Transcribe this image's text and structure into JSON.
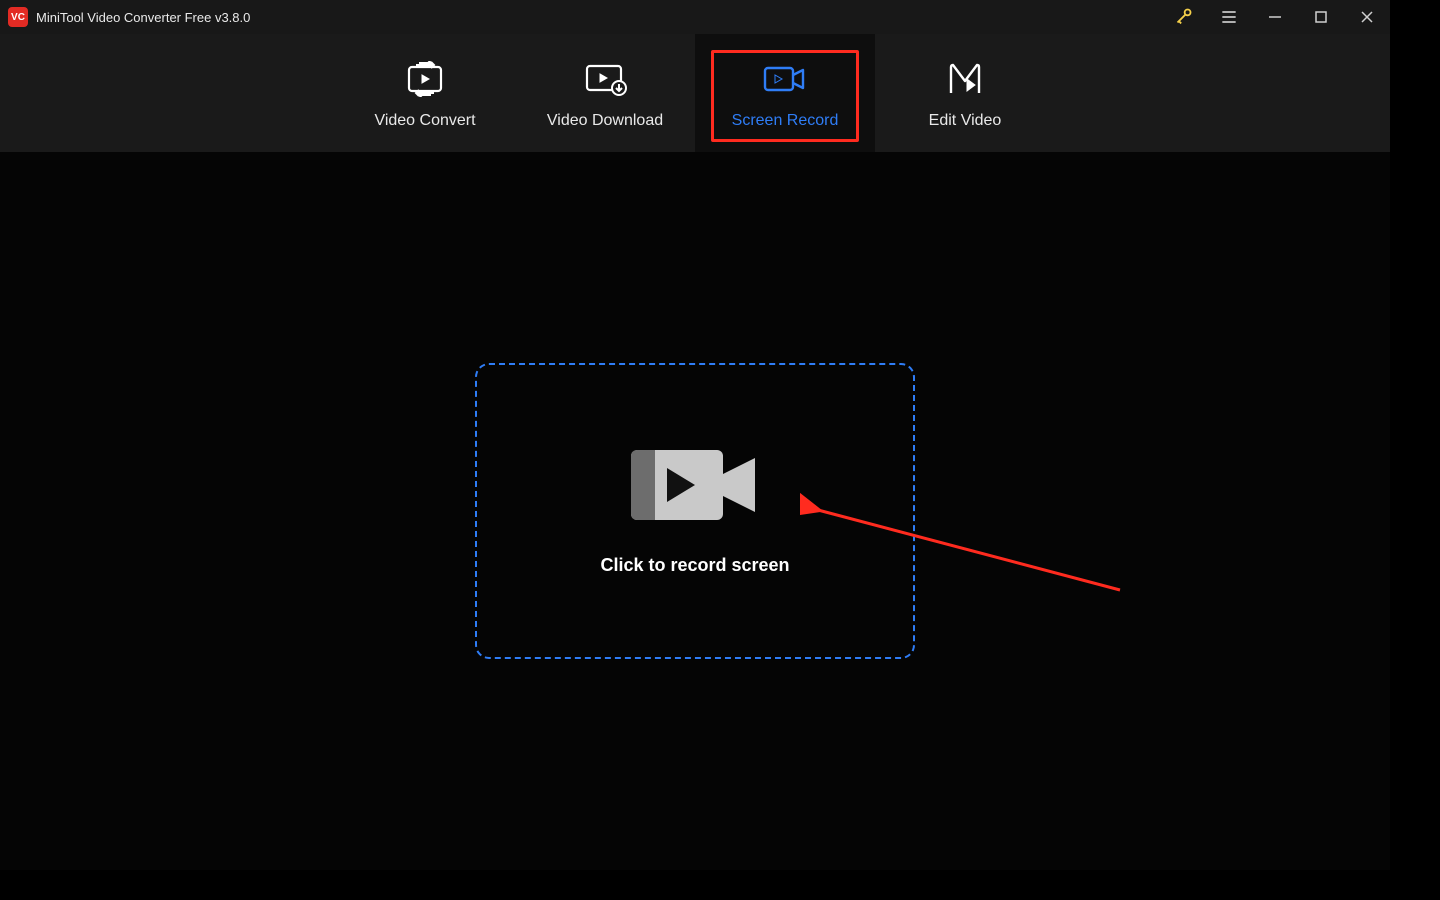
{
  "titlebar": {
    "app_abbrev": "VC",
    "title": "MiniTool Video Converter Free v3.8.0"
  },
  "tabs": {
    "convert": {
      "label": "Video Convert"
    },
    "download": {
      "label": "Video Download"
    },
    "record": {
      "label": "Screen Record"
    },
    "edit": {
      "label": "Edit Video"
    }
  },
  "main": {
    "record_cta": "Click to record screen"
  },
  "colors": {
    "accent": "#2f7df6",
    "highlight": "#ff2b1f"
  }
}
